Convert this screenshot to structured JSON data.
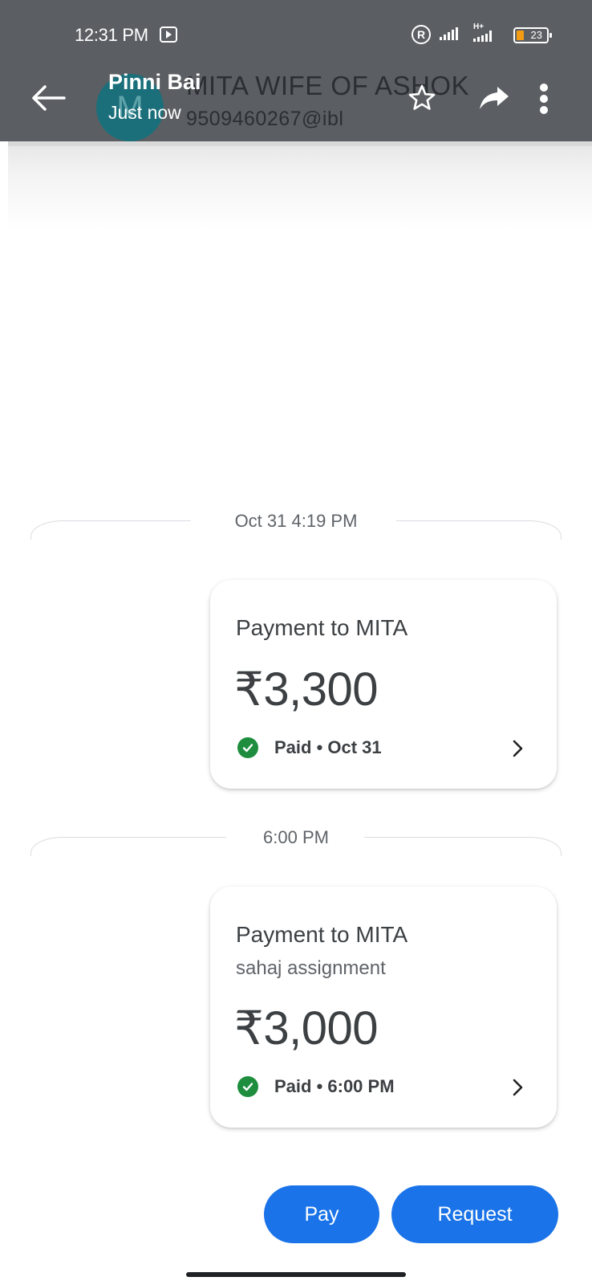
{
  "status_bar": {
    "time": "12:31 PM",
    "network_type": "H+",
    "battery": "23",
    "registered_symbol": "R"
  },
  "header": {
    "chat_name": "Pinni Bai",
    "chat_status": "Just now",
    "contact_name_behind": "MITA WIFE OF ASHOK",
    "contact_upi_behind": "9509460267@ibl",
    "avatar_letter": "M",
    "icons": [
      "back-arrow-icon",
      "star-icon",
      "share-icon",
      "more-vert-icon"
    ]
  },
  "messages": [
    {
      "timestamp": "Oct 31 4:19 PM",
      "title": "Payment to MITA",
      "note": "",
      "amount": "₹3,300",
      "status": "Paid • Oct 31"
    },
    {
      "timestamp": "6:00 PM",
      "title": "Payment to MITA",
      "note": "sahaj assignment",
      "amount": "₹3,000",
      "status": "Paid • 6:00 PM"
    }
  ],
  "actions": {
    "pay_label": "Pay",
    "request_label": "Request"
  },
  "colors": {
    "accent": "#1a73e8",
    "paid_green": "#1e8e3e",
    "overlay": "#5b5f63"
  }
}
